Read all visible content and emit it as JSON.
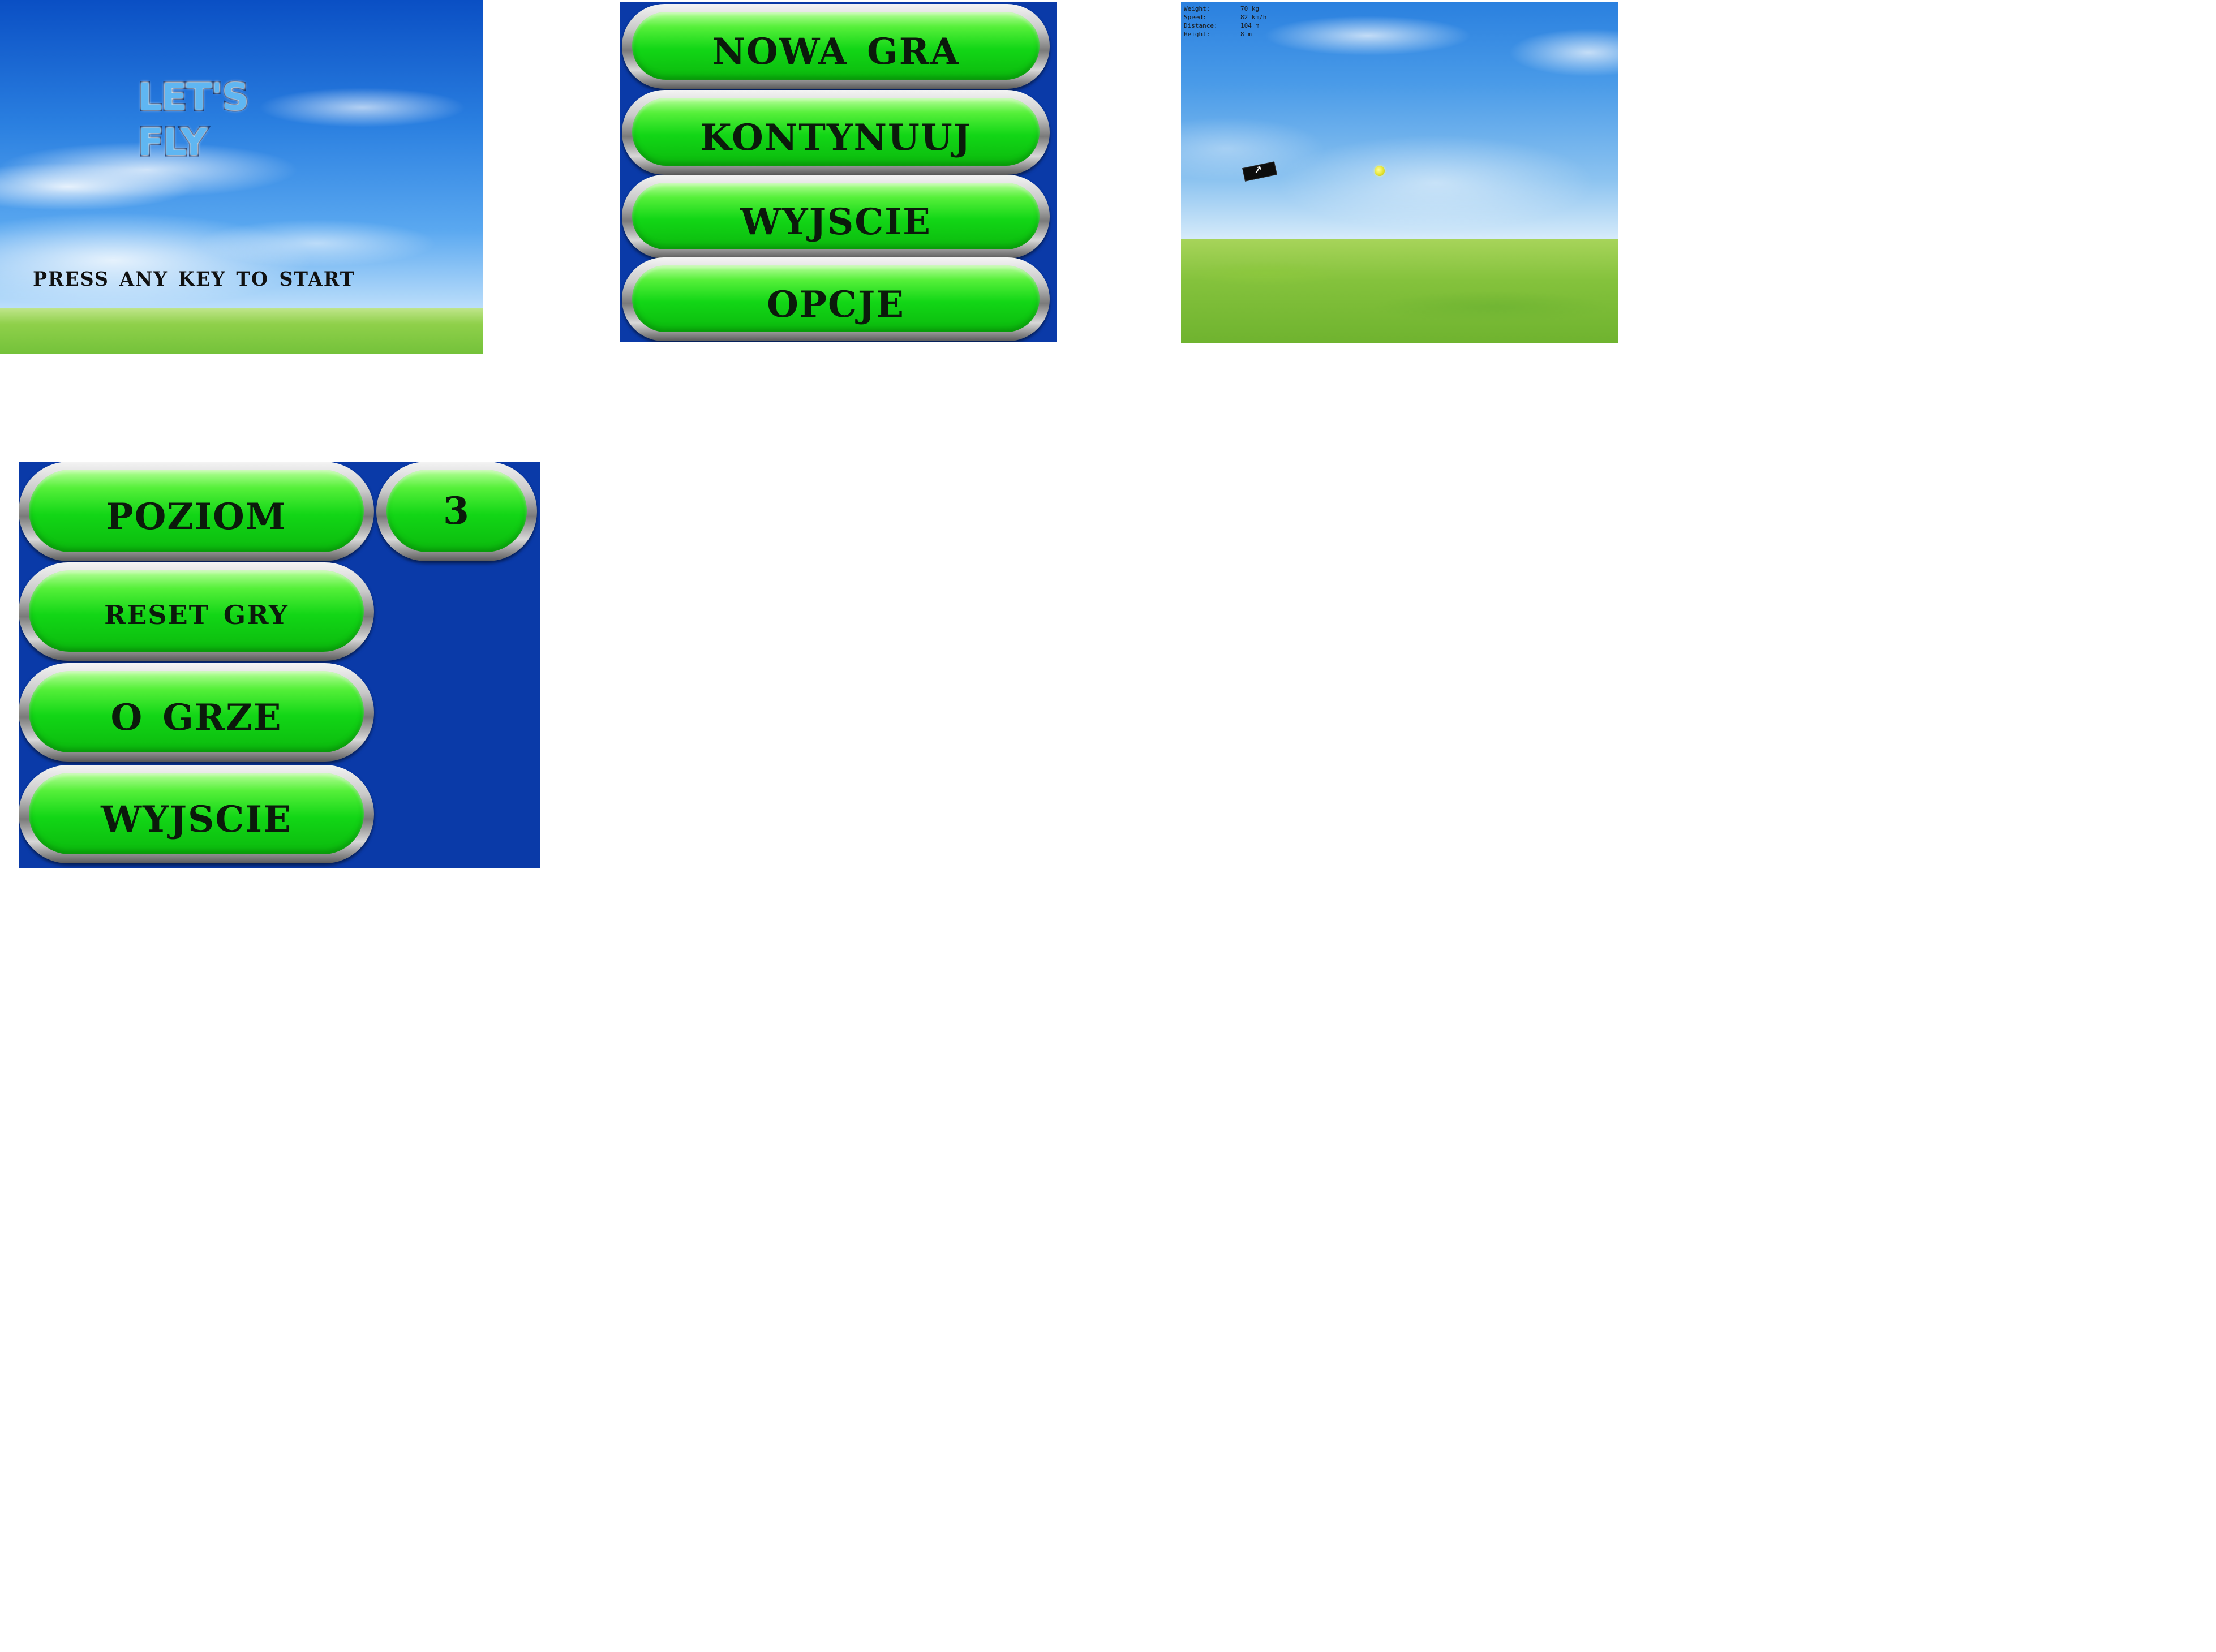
{
  "title_screen": {
    "logo": "LET'S FLY",
    "prompt": "PRESS ANY KEY TO START"
  },
  "main_menu": {
    "items": [
      {
        "label": "NOWA GRA"
      },
      {
        "label": "KONTYNUUJ"
      },
      {
        "label": "WYJSCIE"
      },
      {
        "label": "OPCJE"
      }
    ]
  },
  "gameplay": {
    "hud": [
      {
        "label": "Weight:",
        "value": "70 kg"
      },
      {
        "label": "Speed:",
        "value": "82 km/h"
      },
      {
        "label": "Distance:",
        "value": "104 m"
      },
      {
        "label": "Height:",
        "value": "8 m"
      }
    ],
    "player_icon": "arrow-icon"
  },
  "options_menu": {
    "level_label": "POZIOM",
    "level_value": "3",
    "reset_label": "RESET GRY",
    "about_label": "O GRZE",
    "exit_label": "WYJSCIE"
  },
  "colors": {
    "menu_background": "#0a3aa8",
    "button_green": "#12d616"
  }
}
